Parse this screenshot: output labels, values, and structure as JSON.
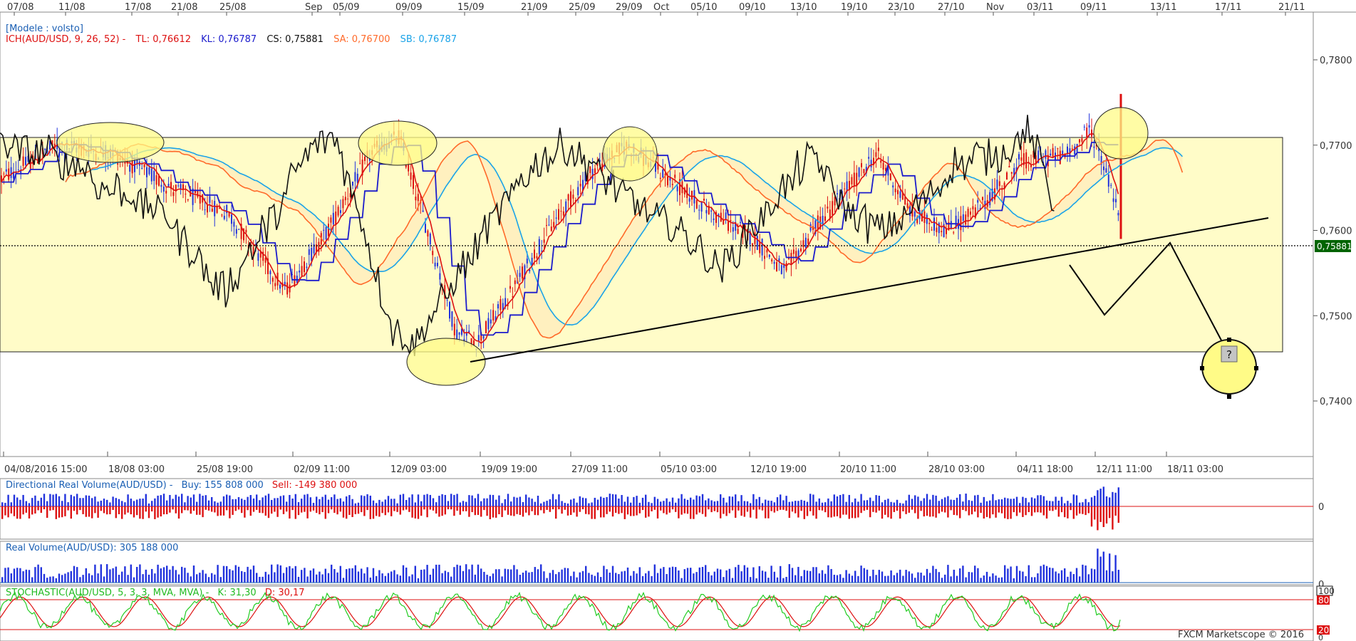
{
  "top_dates": [
    "07/08",
    "11/08",
    "17/08",
    "21/08",
    "25/08",
    "Sep",
    "05/09",
    "09/09",
    "15/09",
    "21/09",
    "25/09",
    "29/09",
    "Oct",
    "05/10",
    "09/10",
    "13/10",
    "19/10",
    "23/10",
    "27/10",
    "Nov",
    "03/11",
    "09/11",
    "13/11",
    "17/11",
    "21/11"
  ],
  "bottom_dates": [
    "04/08/2016 15:00",
    "18/08 03:00",
    "25/08 19:00",
    "02/09 11:00",
    "12/09 03:00",
    "19/09 19:00",
    "27/09 11:00",
    "05/10 03:00",
    "12/10 19:00",
    "20/10 11:00",
    "28/10 03:00",
    "04/11 18:00",
    "12/11 11:00",
    "18/11 03:00"
  ],
  "main": {
    "model": "[Modele : volsto]",
    "ich_prefix": "ICH(AUD/USD, 9, 26, 52) -",
    "tl": "TL: 0,76612",
    "kl": "KL: 0,76787",
    "cs": "CS: 0,75881",
    "sa": "SA: 0,76700",
    "sb": "SB: 0,76787",
    "price_tag": "0,75881",
    "question": "?"
  },
  "drv": {
    "title": "Directional Real Volume(AUD/USD) -",
    "buy": "Buy: 155 808 000",
    "sell": "Sell: -149 380 000",
    "zero": "0"
  },
  "rv": {
    "title": "Real Volume(AUD/USD): 305 188 000",
    "zero": "0"
  },
  "stoch": {
    "title": "STOCHASTIC(AUD/USD, 5, 3, 3, MVA, MVA) -",
    "k": "K: 31,30",
    "d": "D: 30,17",
    "hi": "100",
    "ob": "80",
    "os": "20",
    "lo": "0"
  },
  "footer": "FXCM Marketscope © 2016",
  "colors": {
    "up": "#2233dd",
    "down": "#dd1111",
    "kijun": "#1b1bcc",
    "tenkan": "#dd1111",
    "sa": "#ff6a2a",
    "sb": "#1aa3e8",
    "chikou": "#111111",
    "zone": "#fffcc8",
    "ellipse": "#fffb87",
    "k": "#22cc22",
    "d": "#dd1111"
  },
  "chart_data": {
    "type": "candlestick",
    "title": "AUD/USD",
    "y_ticks": [
      0.74,
      0.75,
      0.76,
      0.77,
      0.78
    ],
    "y_tick_labels": [
      "0,7400",
      "0,7500",
      "0,7600",
      "0,7700",
      "0,7800"
    ],
    "ylim": [
      0.7355,
      0.7905
    ],
    "current_price": 0.75881,
    "range_box": [
      0.7462,
      0.7722
    ],
    "trendline": [
      [
        0.745,
        0.7625
      ]
    ],
    "projection_points": [
      0.755,
      0.7505,
      0.7594,
      0.7452
    ],
    "series": [
      {
        "name": "TL",
        "last": 0.76612
      },
      {
        "name": "KL",
        "last": 0.76787
      },
      {
        "name": "CS",
        "last": 0.75881
      },
      {
        "name": "SA",
        "last": 0.767
      },
      {
        "name": "SB",
        "last": 0.76787
      }
    ]
  }
}
